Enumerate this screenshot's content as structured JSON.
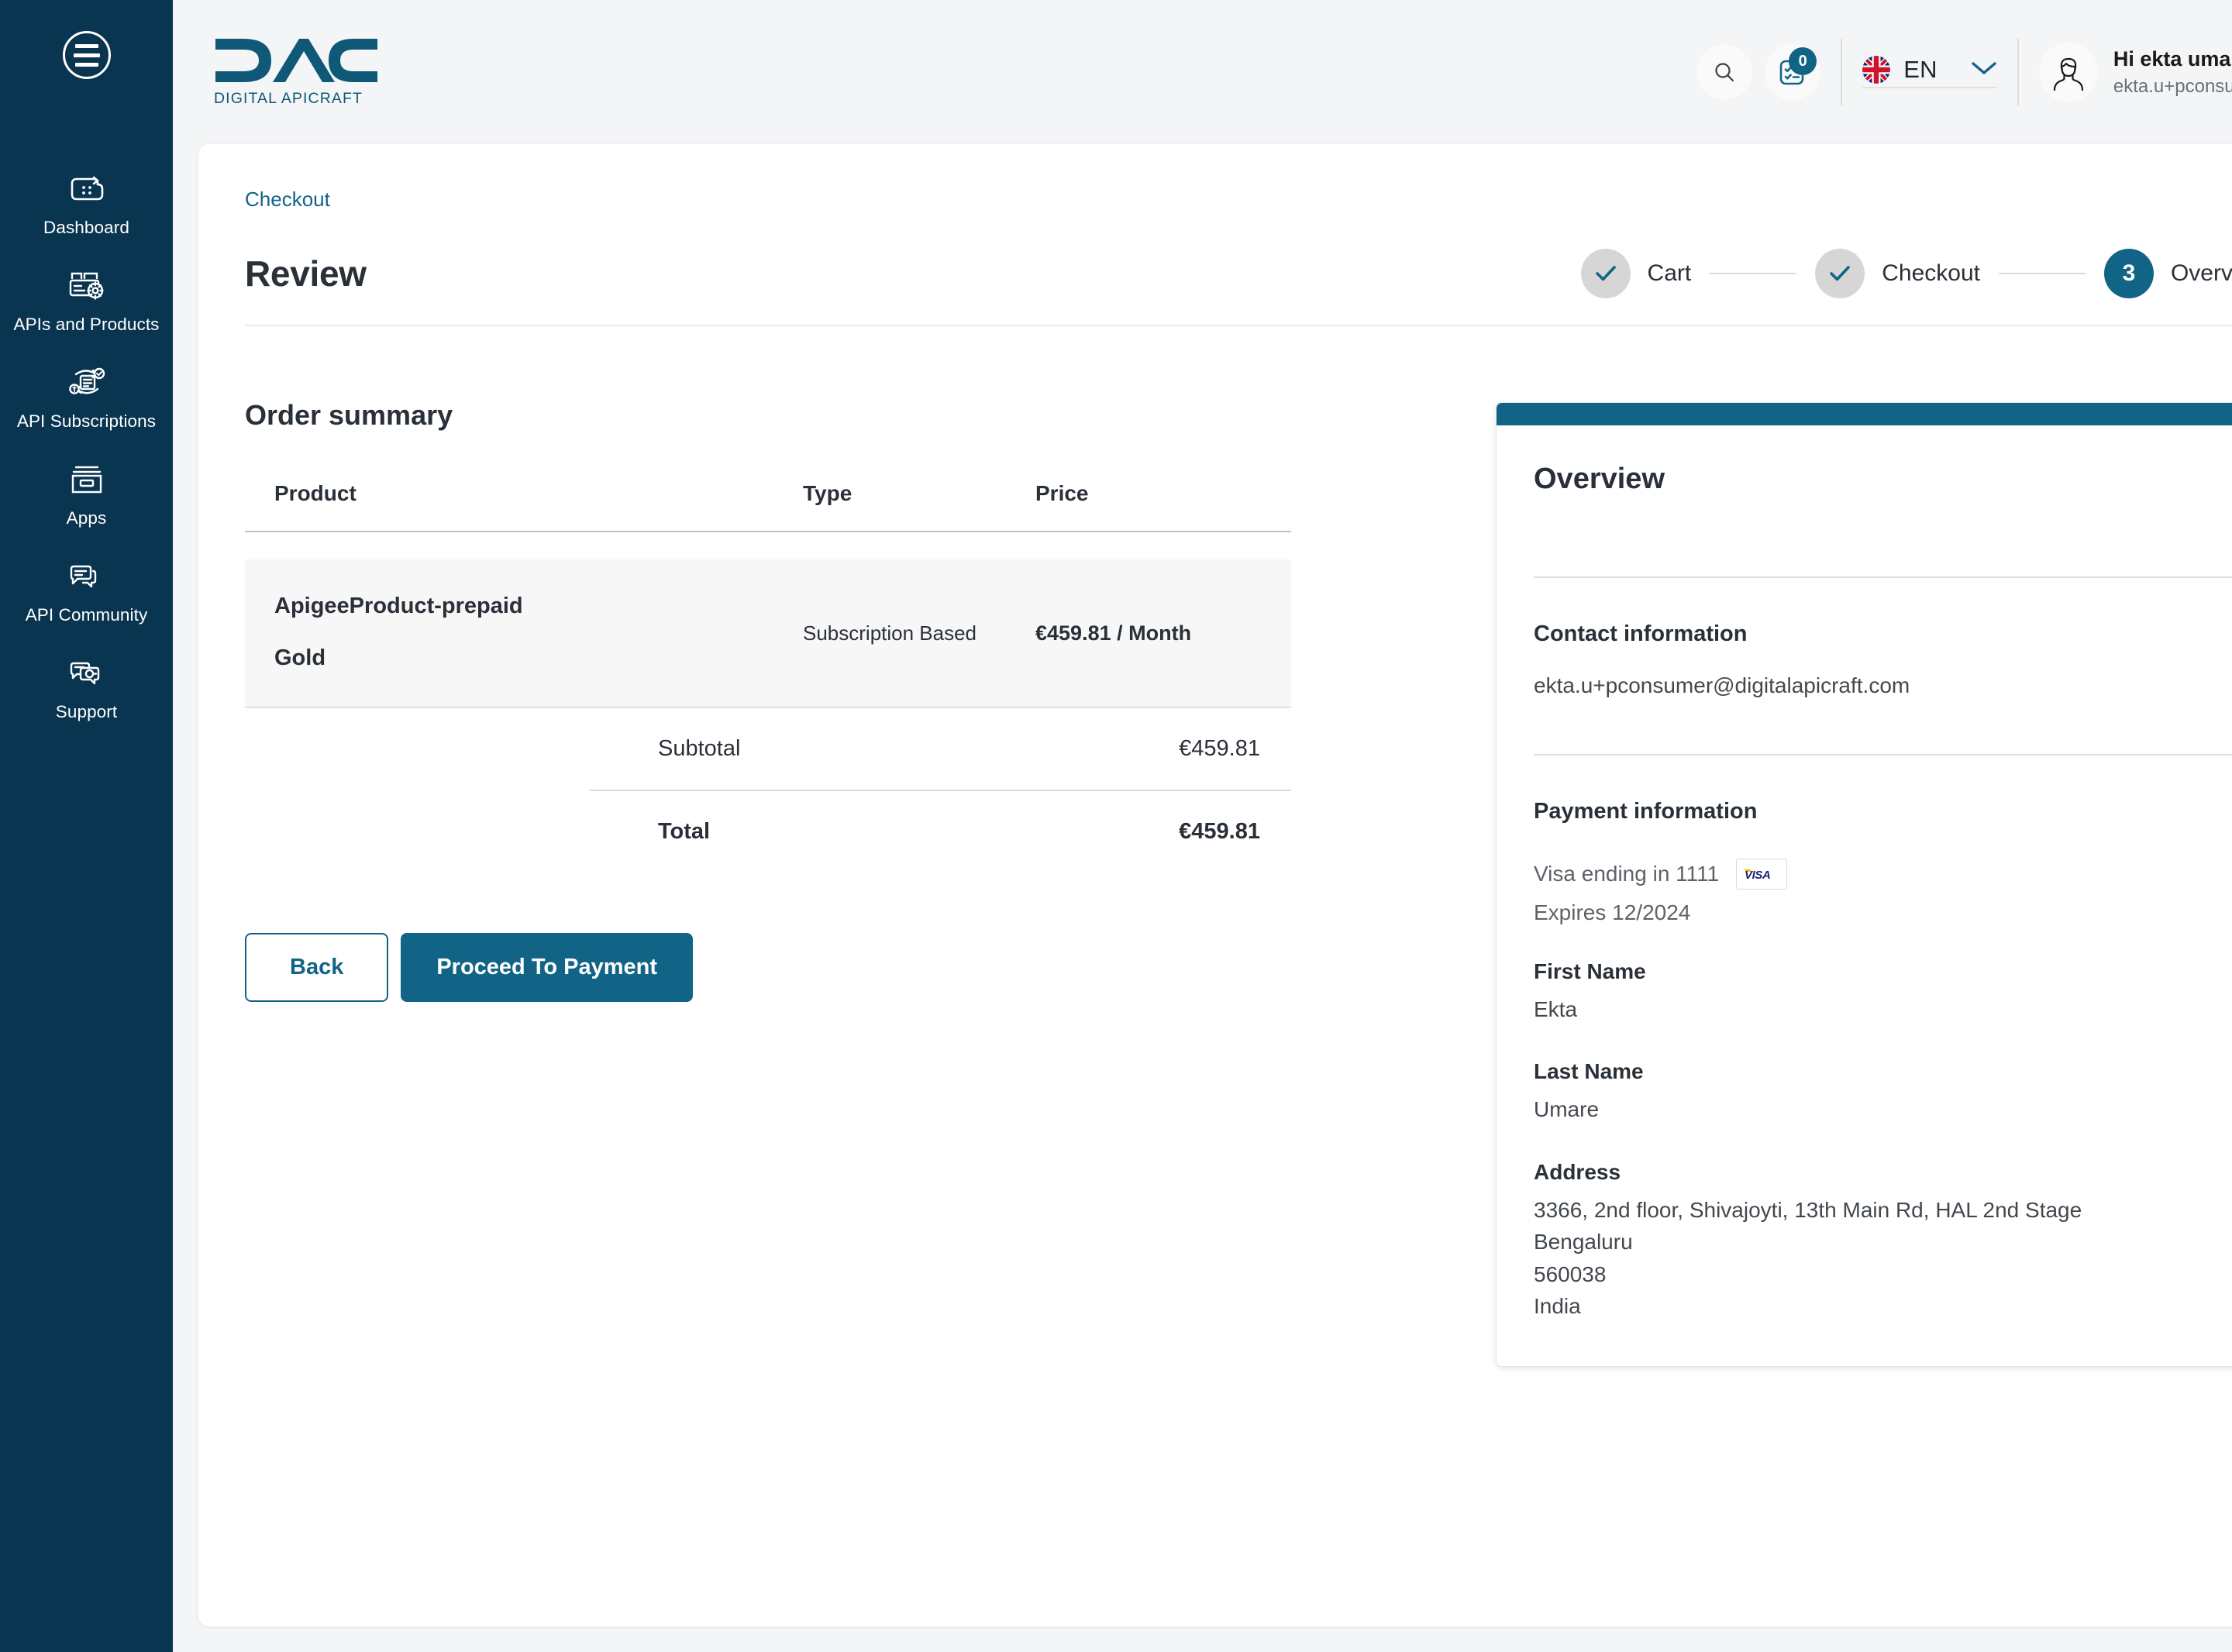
{
  "sidebar": {
    "menu_icon": "hamburger-menu-icon",
    "items": [
      {
        "label": "Dashboard",
        "icon": "dashboard-icon"
      },
      {
        "label": "APIs and Products",
        "icon": "apis-products-icon"
      },
      {
        "label": "API Subscriptions",
        "icon": "api-subscriptions-icon"
      },
      {
        "label": "Apps",
        "icon": "apps-icon"
      },
      {
        "label": "API Community",
        "icon": "api-community-icon"
      },
      {
        "label": "Support",
        "icon": "support-icon"
      }
    ]
  },
  "header": {
    "logo_text": "DAC",
    "logo_tagline": "DIGITAL APICRAFT",
    "search_icon": "search-icon",
    "tasks_icon": "checklist-icon",
    "tasks_badge": "0",
    "language": "EN",
    "language_flag": "uk-flag-icon",
    "user_greeting": "Hi ekta umare",
    "user_email": "ekta.u+pconsume...",
    "avatar_icon": "user-avatar-icon"
  },
  "page": {
    "breadcrumb": "Checkout",
    "title": "Review"
  },
  "stepper": {
    "steps": [
      {
        "label": "Cart",
        "state": "done",
        "marker": "check-icon"
      },
      {
        "label": "Checkout",
        "state": "done",
        "marker": "check-icon"
      },
      {
        "label": "Overview",
        "state": "active",
        "marker": "3"
      }
    ]
  },
  "order": {
    "section_title": "Order summary",
    "columns": {
      "product": "Product",
      "type": "Type",
      "price": "Price"
    },
    "rows": [
      {
        "product_name": "ApigeeProduct-prepaid",
        "product_tier": "Gold",
        "type": "Subscription Based",
        "price": "€459.81 / Month"
      }
    ],
    "subtotal_label": "Subtotal",
    "subtotal_value": "€459.81",
    "total_label": "Total",
    "total_value": "€459.81"
  },
  "overview": {
    "title": "Overview",
    "contact_heading": "Contact information",
    "contact_email": "ekta.u+pconsumer@digitalapicraft.com",
    "payment_heading": "Payment information",
    "card_text": "Visa ending in 1111",
    "card_brand": "VISA",
    "card_expires": "Expires 12/2024",
    "first_name_label": "First Name",
    "first_name_value": "Ekta",
    "last_name_label": "Last Name",
    "last_name_value": "Umare",
    "address_label": "Address",
    "address_line1": "3366, 2nd floor, Shivajoyti, 13th Main Rd, HAL 2nd Stage",
    "address_line2": "Bengaluru",
    "address_line3": "560038",
    "address_line4": "India"
  },
  "actions": {
    "back_label": "Back",
    "proceed_label": "Proceed To Payment"
  },
  "colors": {
    "sidebar_bg": "#0a3551",
    "accent": "#126486",
    "page_bg": "#f4f5f6",
    "row_bg": "#f7f7f8",
    "text": "#2a3038"
  }
}
